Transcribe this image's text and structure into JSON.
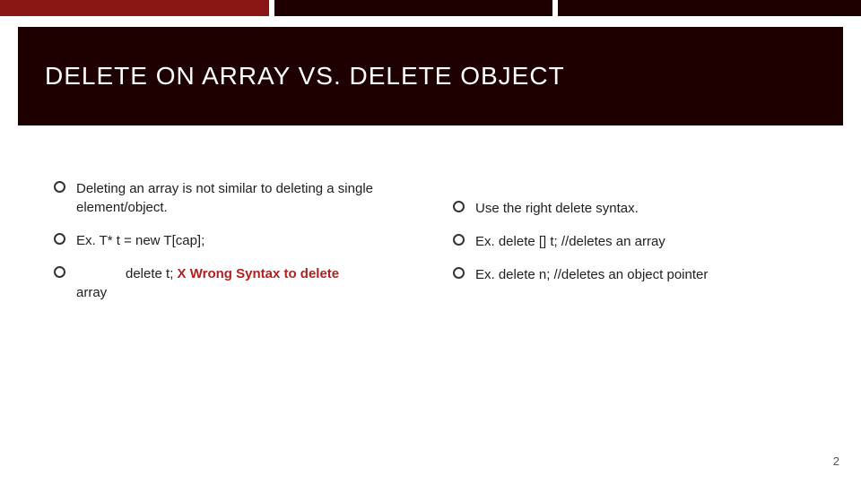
{
  "title": "DELETE ON ARRAY VS. DELETE OBJECT",
  "left": {
    "b1": "Deleting an array is not similar to deleting a single element/object.",
    "b2": "Ex. T* t = new T[cap];",
    "b3_pre": "delete t; ",
    "b3_x": "X",
    "b3_wrong": " Wrong  Syntax to delete",
    "b3_tail": "array"
  },
  "right": {
    "b1": "Use the right delete syntax.",
    "b2": "Ex.  delete [] t; //deletes an array",
    "b3": "Ex.  delete n; //deletes an object pointer"
  },
  "page_number": "2"
}
